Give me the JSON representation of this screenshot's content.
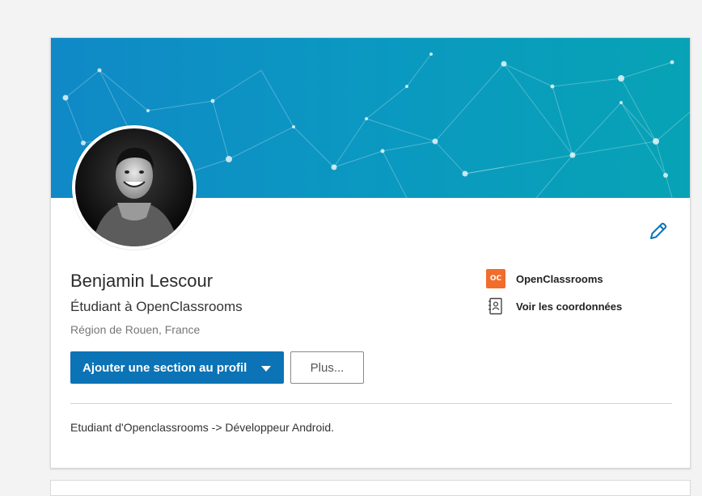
{
  "profile": {
    "name": "Benjamin Lescour",
    "headline": "Étudiant à OpenClassrooms",
    "location": "Région de Rouen, France",
    "summary": "Etudiant d'Openclassrooms -> Développeur Android."
  },
  "sidebar": {
    "company_label": "OpenClassrooms",
    "company_logo_text": "OC",
    "contact_label": "Voir les coordonnées"
  },
  "actions": {
    "add_section_label": "Ajouter une section au profil",
    "more_label": "Plus..."
  },
  "icons": {
    "edit": "pencil-icon",
    "contact": "address-book-icon",
    "dropdown": "caret-down-icon"
  },
  "colors": {
    "primary": "#0b73b6",
    "banner_start": "#1089c6",
    "banner_end": "#07a3b5",
    "oc_brand": "#f26d2b"
  }
}
